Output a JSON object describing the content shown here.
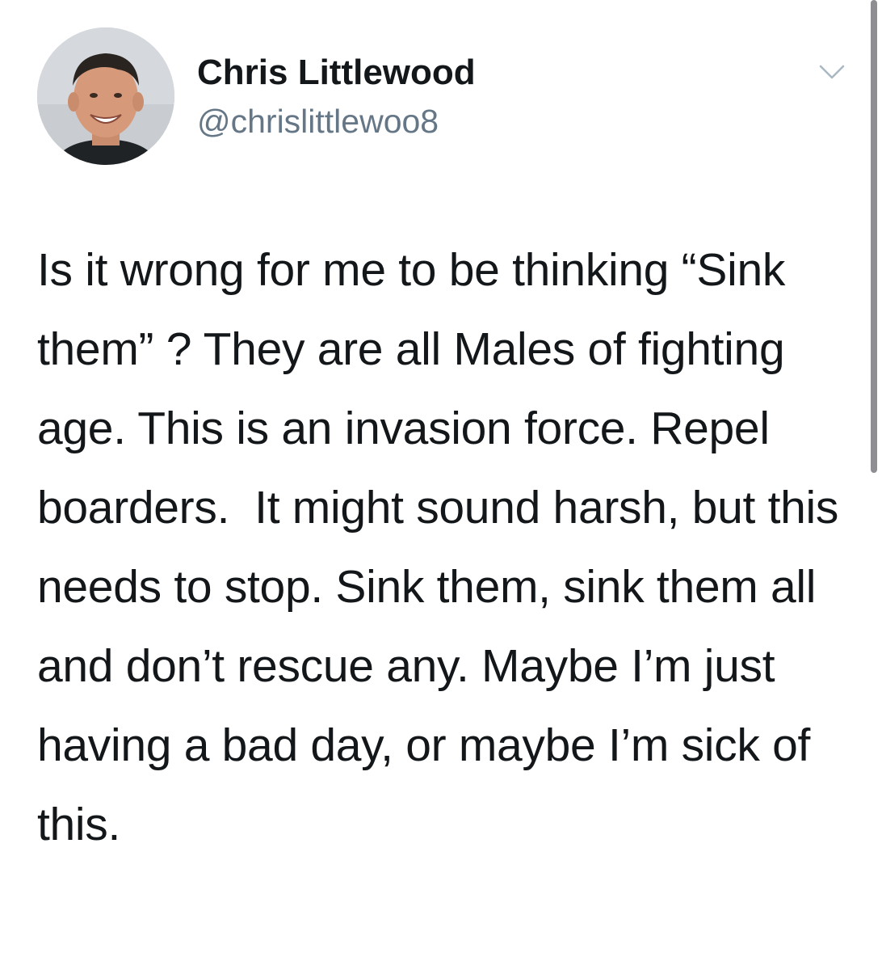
{
  "user": {
    "display_name": "Chris Littlewood",
    "handle": "@chrislittlewoo8",
    "avatar": "avatar-photo"
  },
  "tweet": {
    "text": "Is it wrong for me to be thinking “Sink them” ? They are all Males of fighting age. This is an invasion force. Repel boarders.  It might sound harsh, but this needs to stop. Sink them, sink them all and don’t rescue any. Maybe I’m just having a bad day, or maybe I’m sick of this."
  },
  "icons": {
    "menu": "chevron-down-icon"
  },
  "colors": {
    "text": "#14171a",
    "secondary_text": "#657786",
    "background": "#ffffff",
    "chevron": "#aab8c2",
    "scrollbar": "#8e8e93"
  }
}
